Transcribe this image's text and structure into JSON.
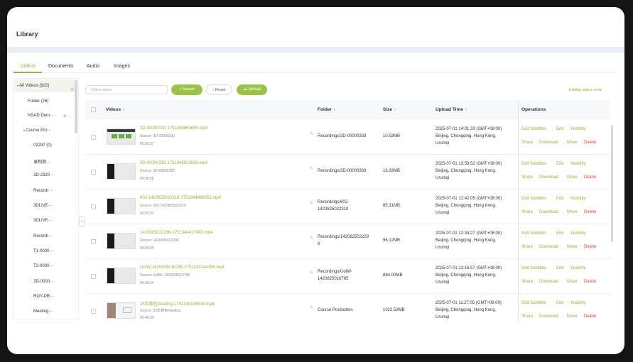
{
  "page": {
    "title": "Library"
  },
  "tabs": [
    {
      "label": "Videos",
      "active": true
    },
    {
      "label": "Documents",
      "active": false
    },
    {
      "label": "Audio",
      "active": false
    },
    {
      "label": "Images",
      "active": false
    }
  ],
  "sidebar": {
    "root": {
      "label": "All Videos",
      "count": "(922)"
    },
    "items": [
      {
        "label": "Folder",
        "count": "(26)"
      },
      {
        "label": "NSAD Dem···"
      },
      {
        "label": "Course Pro···"
      },
      {
        "label": "02297",
        "count": "(0)"
      },
      {
        "label": "录制测···"
      },
      {
        "label": "3D-2320···"
      },
      {
        "label": "Recordi···"
      },
      {
        "label": "3DLIVE···"
      },
      {
        "label": "3DLIVE···"
      },
      {
        "label": "Recordi···"
      },
      {
        "label": "T1-0000···"
      },
      {
        "label": "T2-0000···"
      },
      {
        "label": "2D-0000···"
      },
      {
        "label": "ROY-DR···"
      },
      {
        "label": "Meeting···"
      }
    ],
    "collapse_glyph": "«"
  },
  "toolbar": {
    "search_placeholder": "Video name",
    "search_label": "Search",
    "reset_label": "Reset",
    "upload_label": "Upload",
    "editing_status_label": "Editing status view"
  },
  "table": {
    "columns": {
      "videos": "Videos",
      "folder": "Folder",
      "size": "Size",
      "upload_time": "Upload Time",
      "operations": "Operations"
    },
    "ops": {
      "edit_subtitles": "Edit Subtitles",
      "edit": "Edit",
      "visibility": "Visibility",
      "share": "Share",
      "download": "Download",
      "move": "Move",
      "delete": "Delete"
    },
    "rows": [
      {
        "title": "3D-00000333-1751349663695.mp4",
        "source": "Source:  3D-00000333",
        "duration": "00:00:37",
        "folder_line1": "Recordings/3D-00000333",
        "folder_line2": "",
        "size": "10.53MB",
        "time_line1": "2025-07-01 14:01:33 (GMT+08:00)",
        "time_line2": "Beijing, Chongqing, Hong Kong,",
        "time_line3": "Urumqi"
      },
      {
        "title": "3D-00000333-1751349523055.mp4",
        "source": "Source:  3D-00000333",
        "duration": "00:00:58",
        "folder_line1": "Recordings/3D-00000333",
        "folder_line2": "",
        "size": "16.33MB",
        "time_line1": "2025-07-01 13:58:52 (GMT+08:00)",
        "time_line2": "Beijing, Chongqing, Hong Kong,",
        "time_line3": "Urumqi"
      },
      {
        "title": "602-1420825022310-1751344896351.mp4",
        "source": "Source:  602-1420825022310",
        "duration": "00:03:20",
        "folder_line1": "Recordings/602-",
        "folder_line2": "1420825022310",
        "size": "85.31MB",
        "time_line1": "2025-07-01 12:42:05 (GMT+08:00)",
        "time_line2": "Beijing, Chongqing, Hong Kong,",
        "time_line3": "Urumqi"
      },
      {
        "title": "1420825022296-1751344417493.mp4",
        "source": "Source:  1420825022296",
        "duration": "00:09:09",
        "folder_line1": "Recordings/142082502229",
        "folder_line2": "6",
        "size": "96.12MB",
        "time_line1": "2025-07-01 12:34:27 (GMT+08:00)",
        "time_line2": "Beijing, Chongqing, Hong Kong,",
        "time_line3": "Urumqi"
      },
      {
        "title": "UofW-1420825016785-1751343144156.mp4",
        "source": "Source:  UofW- 1420825016785",
        "duration": "00:36:14",
        "folder_line1": "Recordings/UofW-",
        "folder_line2": "1420825016785",
        "size": "884.00MB",
        "time_line1": "2025-07-01 12:16:57 (GMT+08:00)",
        "time_line2": "Beijing, Chongqing, Hong Kong,",
        "time_line3": "Urumqi"
      },
      {
        "title": "25年黄色meeting-1751340026916.mp4",
        "source": "Source:  25年黄色meeting",
        "duration": "00:49:39",
        "folder_line1": "Course Production",
        "folder_line2": "",
        "size": "1022.53MB",
        "time_line1": "2025-07-01 11:27:05 (GMT+08:00)",
        "time_line2": "Beijing, Chongqing, Hong Kong,",
        "time_line3": "Urumqi"
      }
    ]
  },
  "colors": {
    "accent": "#9bc24a",
    "accent_text": "#8fb33c",
    "danger": "#e04040"
  },
  "icons": [
    "search-icon",
    "reset-icon",
    "upload-icon",
    "edit-pencil-icon",
    "sort-icon",
    "more-icon",
    "collapse-icon"
  ]
}
